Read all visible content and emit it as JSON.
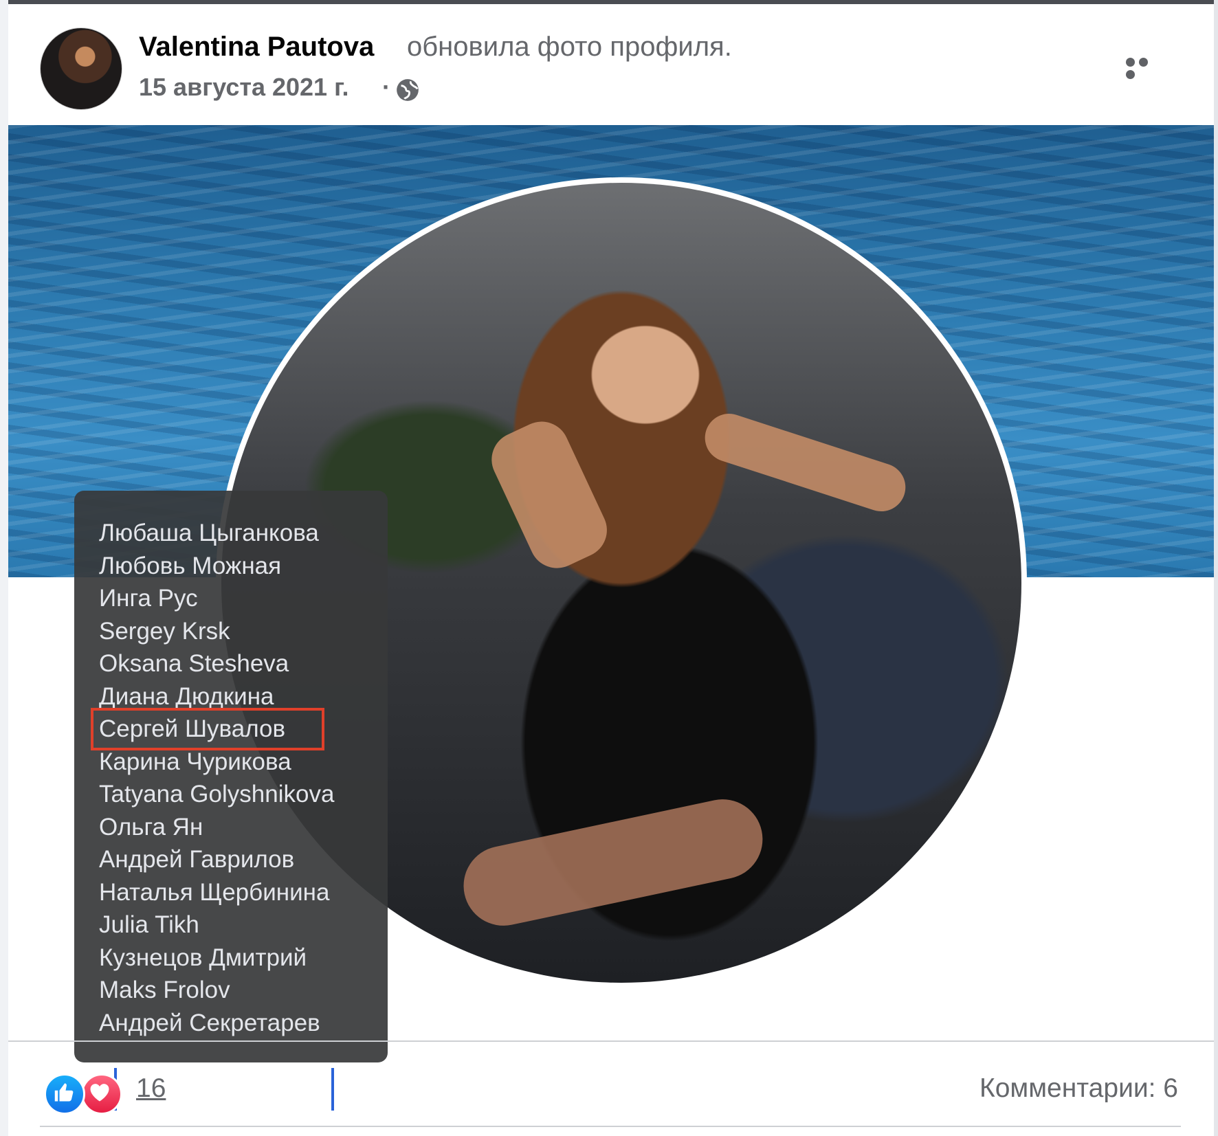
{
  "post": {
    "author": "Valentina Pautova",
    "action": "обновила фото профиля.",
    "date": "15 августа 2021 г.",
    "separator": "·",
    "privacy_icon": "globe-icon",
    "menu_icon": "more-options-icon"
  },
  "tooltip": {
    "names": [
      "Любаша Цыганкова",
      "Любовь Можная",
      "Инга Рус",
      "Sergey Krsk",
      "Oksana Stesheva",
      "Диана Дюдкина",
      "Сергей Шувалов",
      "Карина Чурикова",
      "Tatyana Golyshnikova",
      "Ольга Ян",
      "Андрей Гаврилов",
      "Наталья Щербинина",
      "Julia Tikh",
      "Кузнецов Дмитрий",
      "Maks Frolov",
      "Андрей Секретарев"
    ],
    "highlighted": "Сергей Шувалов",
    "highlight_color": "#e0402a"
  },
  "reactions": {
    "icons": [
      "like-icon",
      "love-icon"
    ],
    "count": "16",
    "comments": "Комментарии: 6"
  },
  "colors": {
    "text_primary": "#050505",
    "text_secondary": "#65676b",
    "like_blue": "#1877f2",
    "love_red": "#f33e58"
  }
}
